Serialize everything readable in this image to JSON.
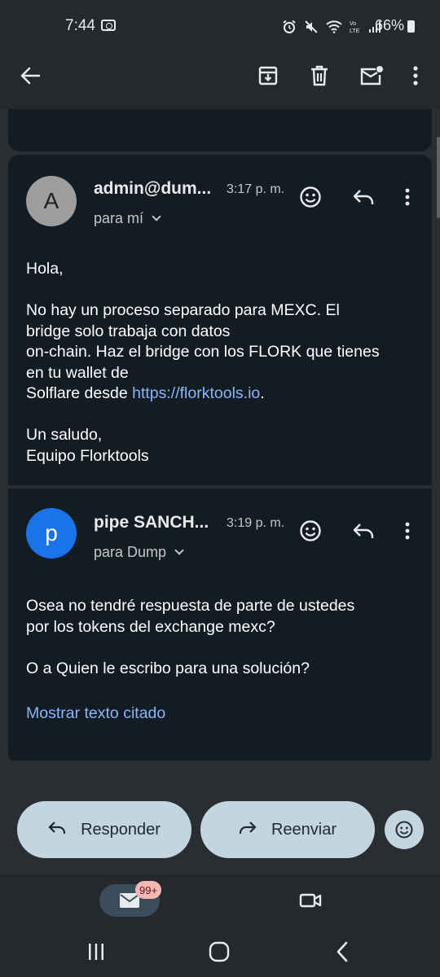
{
  "status_bar": {
    "time": "7:44",
    "battery": "66%",
    "icons": [
      "camera-icon",
      "alarm-icon",
      "mute-icon",
      "wifi-icon",
      "volte-icon",
      "signal-icon",
      "battery-icon"
    ]
  },
  "toolbar": {
    "icons": [
      "back-arrow-icon",
      "archive-icon",
      "delete-icon",
      "mark-unread-icon",
      "more-vert-icon"
    ]
  },
  "messages": [
    {
      "avatar_letter": "A",
      "avatar_color": "#9e9e9e",
      "sender": "admin@dum...",
      "time": "3:17 p. m.",
      "recipient": "para mí",
      "body": {
        "greeting": "Hola,",
        "p1_line1": "No hay un proceso separado para MEXC. El",
        "p1_line2": "bridge solo trabaja con datos",
        "p1_line3": "on-chain. Haz el bridge con los FLORK que tienes",
        "p1_line4": "en tu wallet de",
        "p1_line5_pre": "Solflare desde ",
        "p1_link": "https://florktools.io",
        "p1_line5_post": ".",
        "sign1": "Un saludo,",
        "sign2": "Equipo Florktools"
      }
    },
    {
      "avatar_letter": "p",
      "avatar_color": "#1a73e8",
      "sender": "pipe SANCH...",
      "time": "3:19 p. m.",
      "recipient": "para Dump",
      "body": {
        "line1": "Osea no tendré respuesta de parte de ustedes",
        "line2": "por los tokens del exchange mexc?",
        "line3": "O a Quien le escribo para una solución?"
      },
      "quoted_label": "Mostrar texto citado"
    }
  ],
  "actions": {
    "reply_label": "Responder",
    "forward_label": "Reenviar"
  },
  "bottom_nav": {
    "mail_badge": "99+"
  }
}
